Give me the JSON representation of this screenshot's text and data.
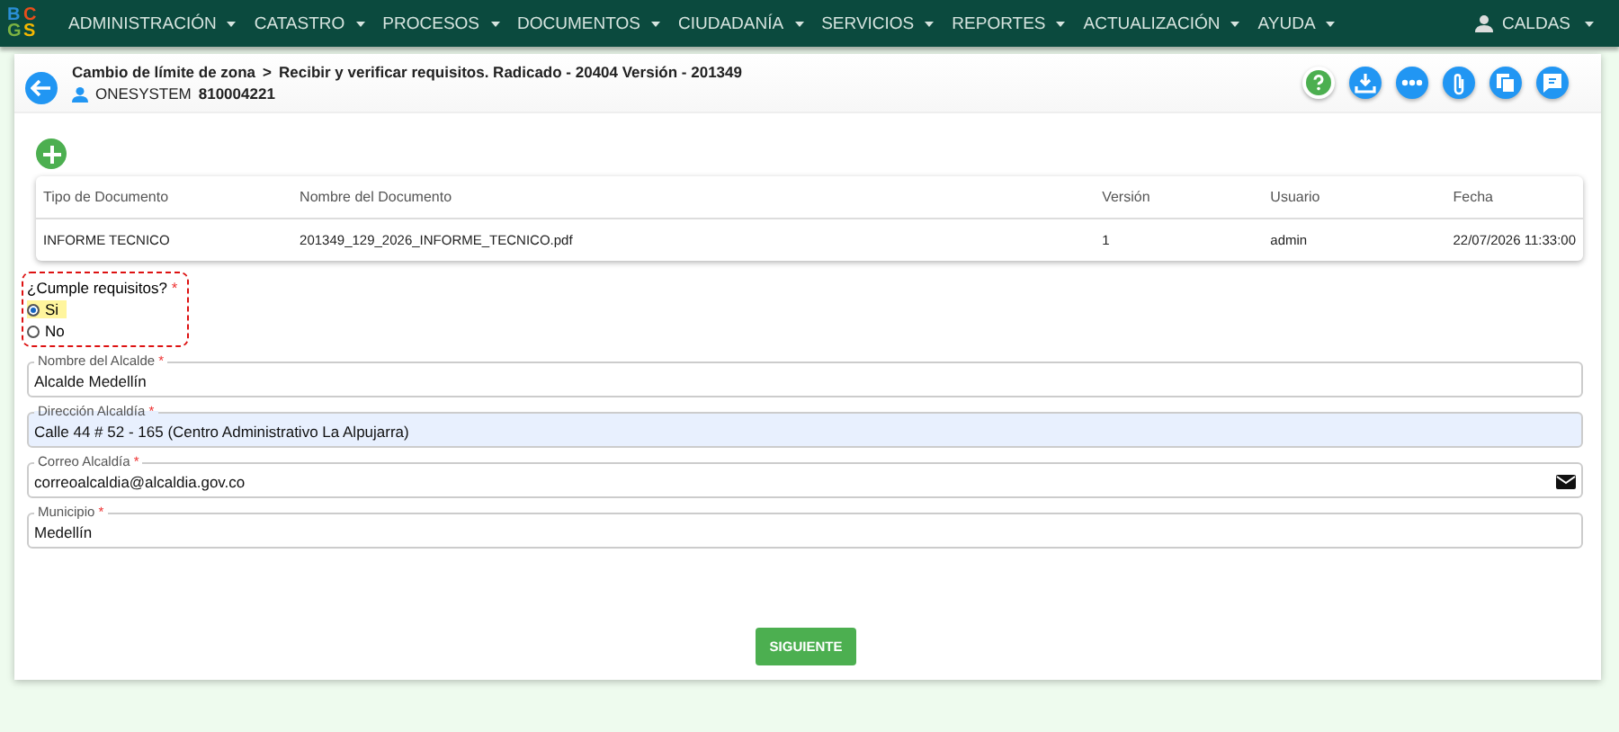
{
  "logo": {
    "letters": [
      "B",
      "C",
      "G",
      "S"
    ]
  },
  "menu": [
    {
      "label": "ADMINISTRACIÓN"
    },
    {
      "label": "CATASTRO"
    },
    {
      "label": "PROCESOS"
    },
    {
      "label": "DOCUMENTOS"
    },
    {
      "label": "CIUDADANÍA"
    },
    {
      "label": "SERVICIOS"
    },
    {
      "label": "REPORTES"
    },
    {
      "label": "ACTUALIZACIÓN"
    },
    {
      "label": "AYUDA"
    }
  ],
  "user": {
    "label": "CALDAS"
  },
  "header": {
    "breadcrumb": [
      "Cambio de límite de zona",
      "Recibir y verificar requisitos. Radicado - 20404 Versión - 201349"
    ],
    "separator": ">",
    "owner": "ONESYSTEM",
    "owner_id": "810004221"
  },
  "toolbar": [
    {
      "kind": "help"
    },
    {
      "kind": "download"
    },
    {
      "kind": "more"
    },
    {
      "kind": "attach"
    },
    {
      "kind": "copy"
    },
    {
      "kind": "comment"
    }
  ],
  "table": {
    "columns": [
      "Tipo de Documento",
      "Nombre del Documento",
      "Versión",
      "Usuario",
      "Fecha"
    ],
    "rows": [
      [
        "INFORME TECNICO",
        "201349_129_2026_INFORME_TECNICO.pdf",
        "1",
        "admin",
        "22/07/2026 11:33:00"
      ]
    ]
  },
  "question": {
    "label": "¿Cumple requisitos?",
    "required_mark": "*",
    "options": [
      {
        "label": "Si",
        "selected": true
      },
      {
        "label": "No",
        "selected": false
      }
    ]
  },
  "fields": [
    {
      "kind": "text",
      "label": "Nombre del Alcalde",
      "value": "Alcalde Medellín",
      "highlighted": false
    },
    {
      "kind": "text",
      "label": "Dirección Alcaldía",
      "value": "Calle 44 # 52 - 165 (Centro Administrativo La Alpujarra)",
      "highlighted": true
    },
    {
      "kind": "email",
      "label": "Correo Alcaldía",
      "value": "correoalcaldia@alcaldia.gov.co",
      "highlighted": false
    },
    {
      "kind": "text",
      "label": "Municipio",
      "value": "Medellín",
      "highlighted": false
    }
  ],
  "required_mark": "*",
  "next_button": "SIGUIENTE"
}
